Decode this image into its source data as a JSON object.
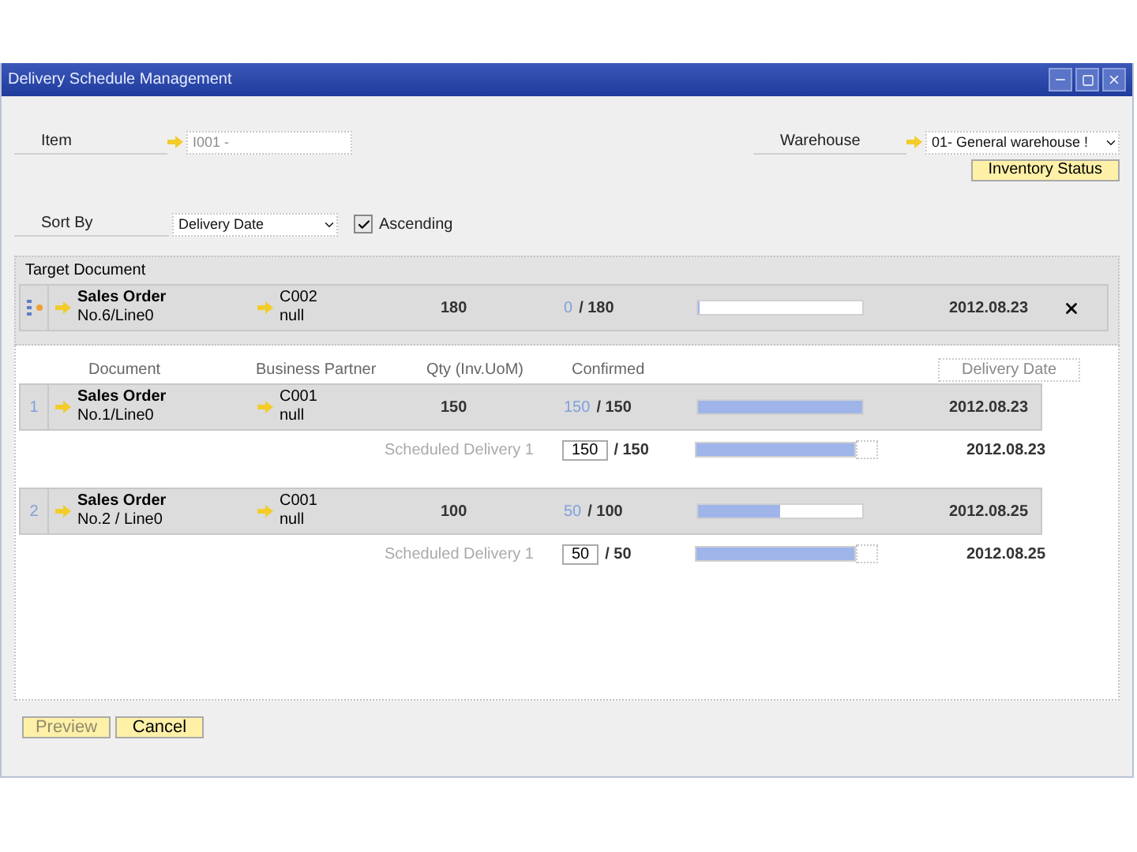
{
  "window": {
    "title": "Delivery Schedule Management"
  },
  "item": {
    "label": "Item",
    "value": "I001 -",
    "disabled": true
  },
  "warehouse": {
    "label": "Warehouse",
    "value": "01-  General warehouse !"
  },
  "inventory_button": {
    "label": "Inventory Status"
  },
  "sort": {
    "label": "Sort By",
    "value": "Delivery Date",
    "ascending_label": "Ascending",
    "ascending": true
  },
  "target": {
    "label": "Target Document",
    "doc_type": "Sales Order",
    "doc_no": "No.6/Line0",
    "partner_code": "C002",
    "partner_name": "null",
    "qty": "180",
    "confirmed": "0",
    "total": "/ 180",
    "level": 0,
    "date": "2012.08.23"
  },
  "columns": [
    "Document",
    "Business Partner",
    "Qty (Inv.UoM)",
    "Confirmed",
    "Delivery Date"
  ],
  "orders": [
    {
      "index": "1",
      "doc_type": "Sales Order",
      "doc_no": "No.1/Line0",
      "partner_code": "C001",
      "partner_name": "null",
      "qty": "150",
      "confirmed": "150",
      "total": "/ 150",
      "level": 1,
      "date": "2012.08.23",
      "schedules": [
        {
          "label": "Scheduled Delivery 1",
          "value": "150",
          "total": "/ 150",
          "level": 1,
          "date": "2012.08.23"
        }
      ]
    },
    {
      "index": "2",
      "doc_type": "Sales Order",
      "doc_no": "No.2 / Line0",
      "partner_code": "C001",
      "partner_name": "null",
      "qty": "100",
      "confirmed": "50",
      "total": "/ 100",
      "level": 0.5,
      "date": "2012.08.25",
      "schedules": [
        {
          "label": "Scheduled Delivery 1",
          "value": "50",
          "total": "/ 50",
          "level": 1,
          "date": "2012.08.25"
        }
      ]
    }
  ],
  "buttons": [
    {
      "label": "Preview",
      "disabled": true
    },
    {
      "label": "Cancel",
      "disabled": false
    }
  ]
}
